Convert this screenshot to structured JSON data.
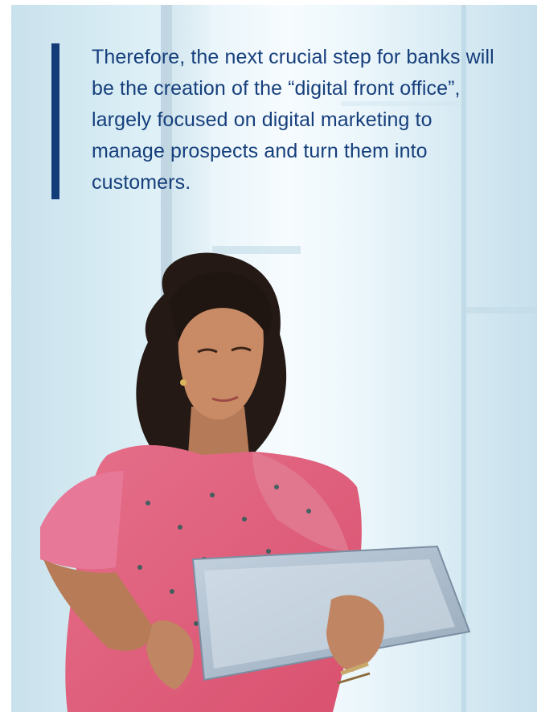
{
  "quote": {
    "text": "Therefore, the next crucial step for banks will be the creation of the “digital front office”, largely focused on digital marketing to manage prospects and turn them into customers."
  },
  "colors": {
    "quote_bar": "#123b78",
    "quote_text": "#163f7c"
  },
  "image": {
    "subject": "woman in pink sari using a tablet by a window"
  }
}
